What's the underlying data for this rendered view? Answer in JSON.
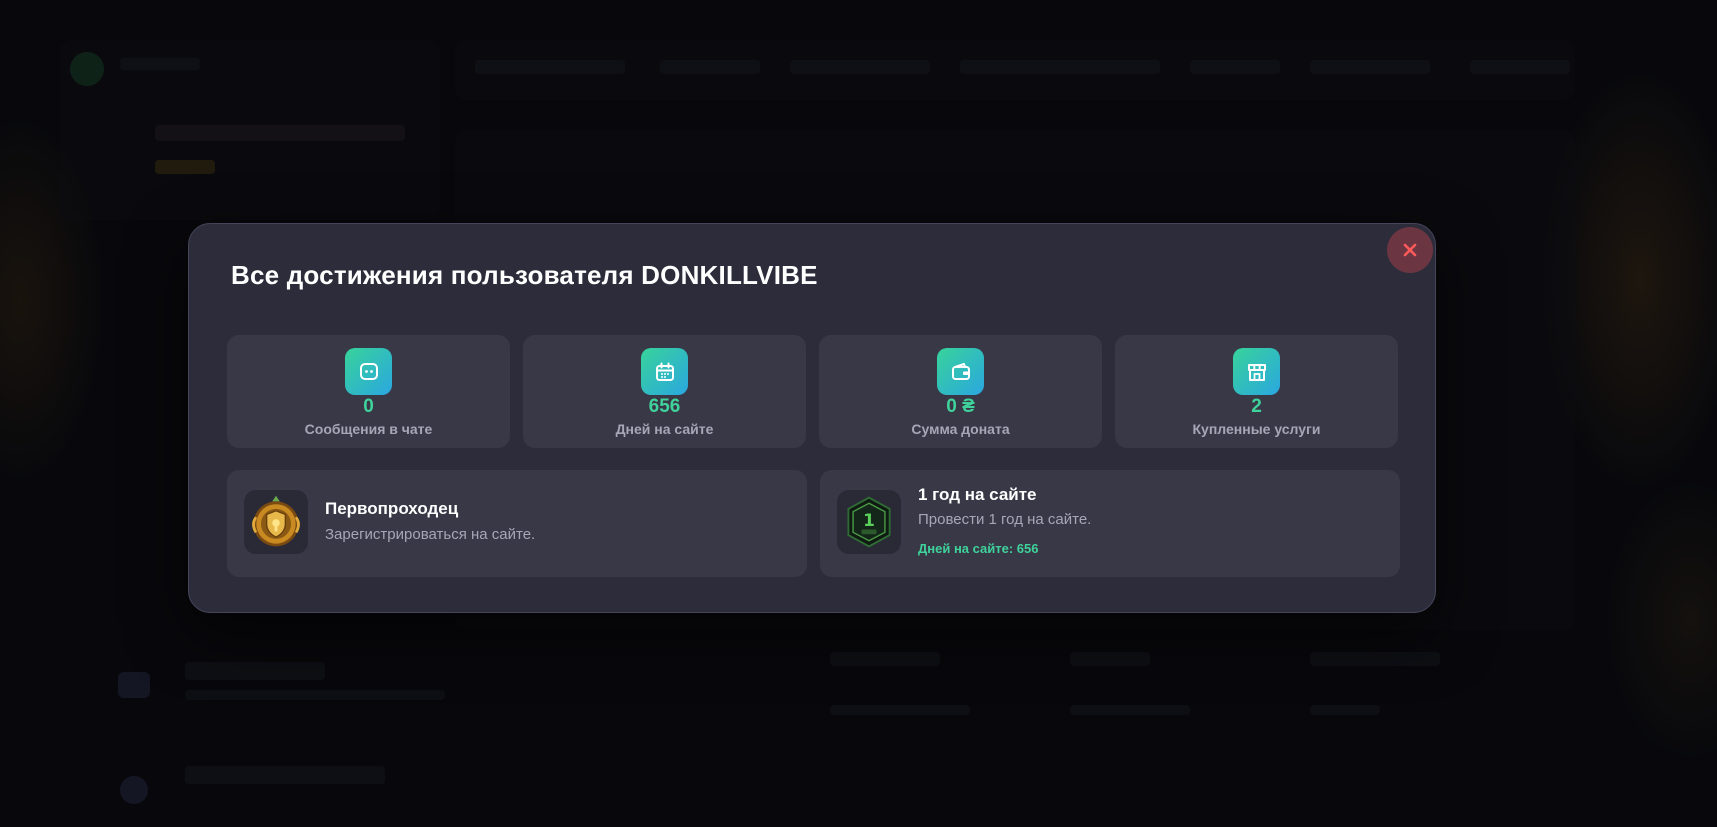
{
  "modal": {
    "title": "Все достижения пользователя DONKILLVIBE",
    "close_icon": "close-icon",
    "stats": [
      {
        "icon": "chat-icon",
        "value": "0",
        "label": "Сообщения в чате"
      },
      {
        "icon": "calendar-icon",
        "value": "656",
        "label": "Дней на сайте"
      },
      {
        "icon": "wallet-icon",
        "value": "0 ₴",
        "label": "Сумма доната"
      },
      {
        "icon": "store-icon",
        "value": "2",
        "label": "Купленные услуги"
      }
    ],
    "achievements": [
      {
        "icon": "gold-medal-icon",
        "title": "Первопроходец",
        "description": "Зарегистрироваться на сайте."
      },
      {
        "icon": "one-year-badge-icon",
        "title": "1 год на сайте",
        "description": "Провести 1 год на сайте.",
        "progress": "Дней на сайте: 656"
      }
    ]
  },
  "colors": {
    "accent_green": "#3fd29a",
    "gradient_start": "#38d39a",
    "gradient_end": "#2aa7e0",
    "close_bg": "#6b3642",
    "close_x": "#ff5a5a",
    "modal_bg": "#2c2c3a",
    "card_bg": "#383847"
  }
}
